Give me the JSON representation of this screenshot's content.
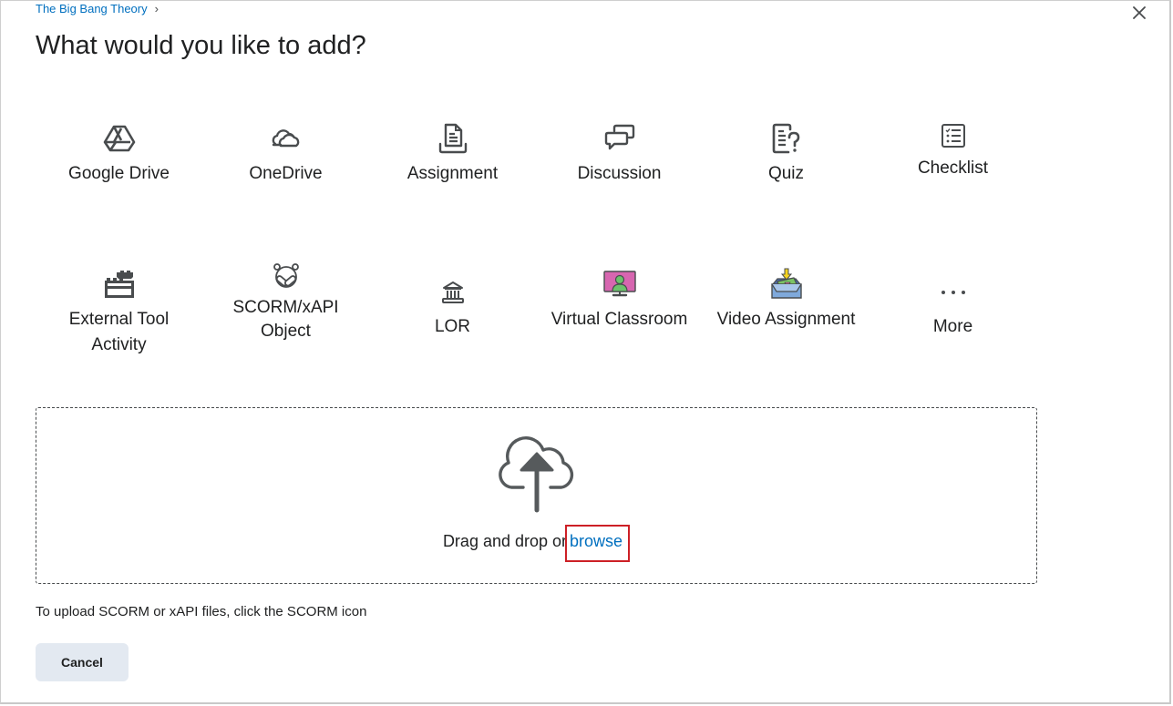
{
  "breadcrumb": {
    "items": [
      {
        "label": "The Big Bang Theory"
      }
    ],
    "separator": "›"
  },
  "dialog": {
    "title": "What would you like to add?",
    "close_icon": "close-icon"
  },
  "tiles": [
    {
      "label": "Google Drive",
      "icon": "google-drive-icon"
    },
    {
      "label": "OneDrive",
      "icon": "onedrive-cloud-icon"
    },
    {
      "label": "Assignment",
      "icon": "assignment-icon"
    },
    {
      "label": "Discussion",
      "icon": "discussion-icon"
    },
    {
      "label": "Quiz",
      "icon": "quiz-icon"
    },
    {
      "label": "Checklist",
      "icon": "checklist-icon"
    },
    {
      "label": "External Tool Activity",
      "icon": "external-tool-blocks-icon"
    },
    {
      "label": "SCORM/xAPI Object",
      "icon": "scorm-icon"
    },
    {
      "label": "LOR",
      "icon": "library-building-icon"
    },
    {
      "label": "Virtual Classroom",
      "icon": "virtual-classroom-icon"
    },
    {
      "label": "Video Assignment",
      "icon": "video-assignment-icon"
    },
    {
      "label": "More",
      "icon": "more-dots-icon"
    }
  ],
  "dropzone": {
    "icon": "cloud-upload-icon",
    "text": "Drag and drop or",
    "browse_label": "browse"
  },
  "hint": "To upload SCORM or xAPI files, click the SCORM icon",
  "footer": {
    "cancel_label": "Cancel"
  },
  "colors": {
    "link": "#006fbf",
    "highlight_border": "#cd2026",
    "icon": "#494c4e",
    "button_bg": "#e3e9f1"
  }
}
